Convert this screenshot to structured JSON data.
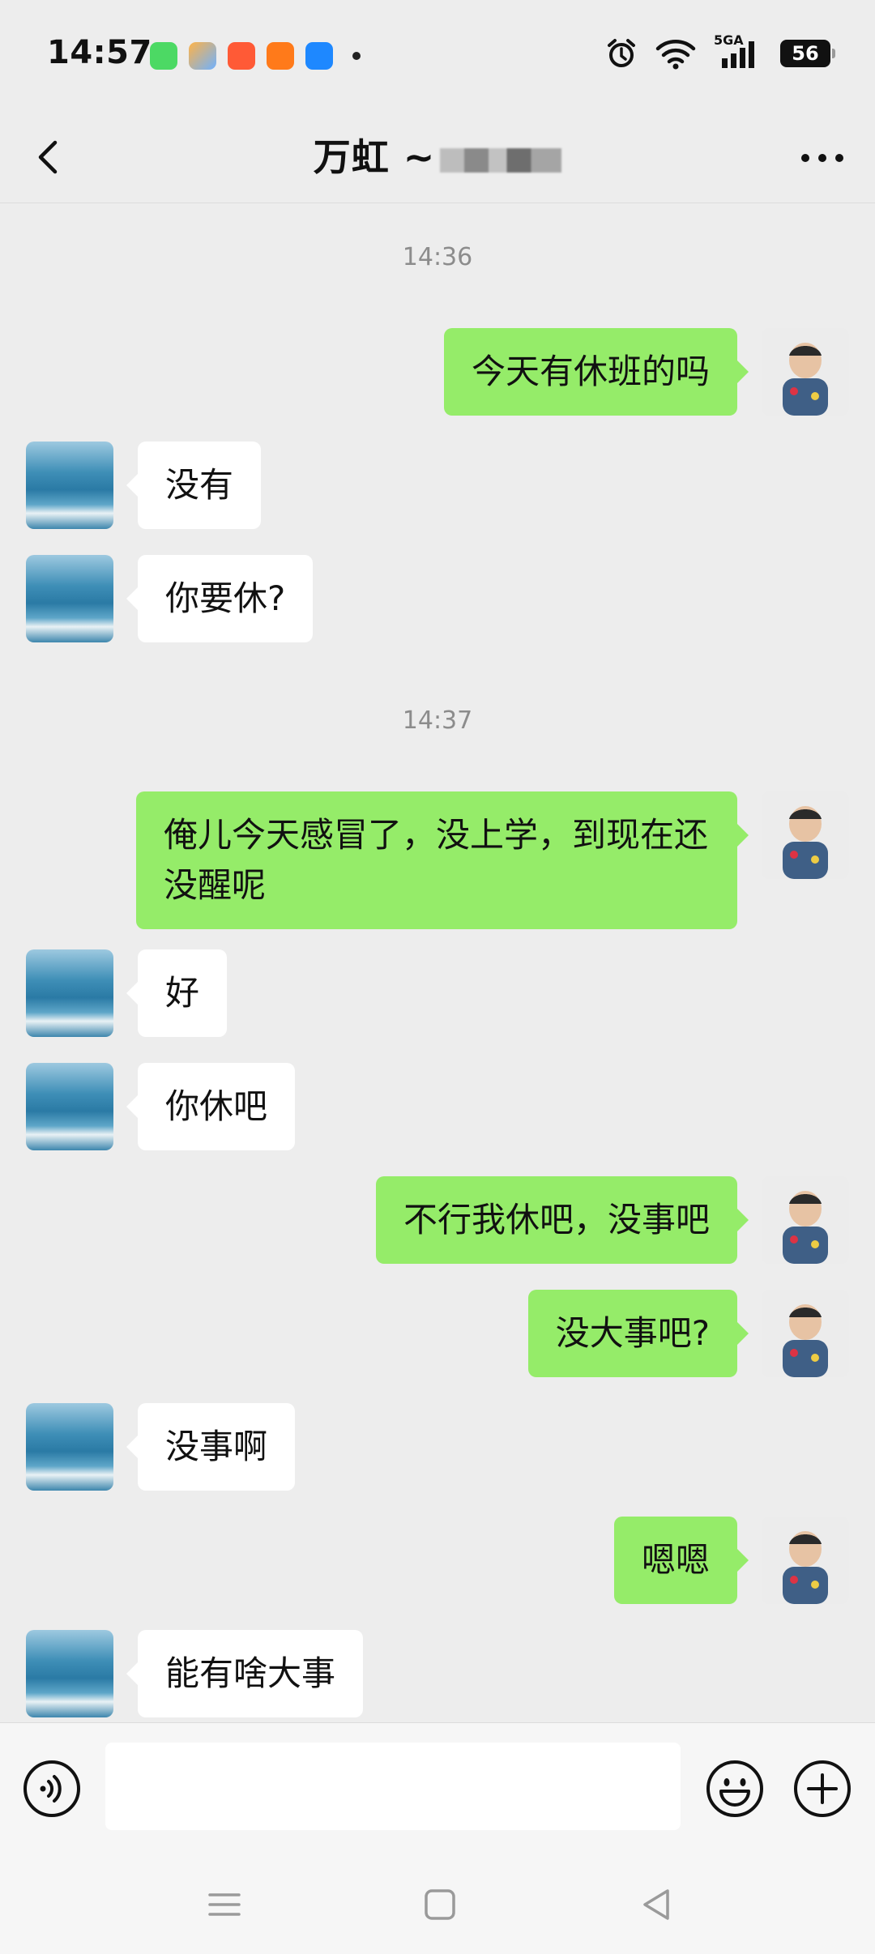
{
  "status_bar": {
    "time": "14:57",
    "network_label": "5GA",
    "battery": "56"
  },
  "header": {
    "title": "万虹 ~",
    "back_icon": "chevron-left-icon",
    "more_icon": "more-dots-icon"
  },
  "chat": {
    "timestamps": [
      "14:36",
      "14:37"
    ],
    "messages": [
      {
        "side": "out",
        "text": "今天有休班的吗"
      },
      {
        "side": "in",
        "text": "没有"
      },
      {
        "side": "in",
        "text": "你要休?"
      },
      {
        "side": "out",
        "text": "俺儿今天感冒了，没上学，到现在还没醒呢"
      },
      {
        "side": "in",
        "text": "好"
      },
      {
        "side": "in",
        "text": "你休吧"
      },
      {
        "side": "out",
        "text": "不行我休吧，没事吧"
      },
      {
        "side": "out",
        "text": "没大事吧?"
      },
      {
        "side": "in",
        "text": "没事啊"
      },
      {
        "side": "out",
        "text": "嗯嗯"
      },
      {
        "side": "in",
        "text": "能有啥大事"
      }
    ]
  },
  "input_bar": {
    "voice_icon": "voice-icon",
    "emoji_icon": "emoji-icon",
    "plus_icon": "plus-icon",
    "input_value": ""
  },
  "nav_bar": {
    "icons": [
      "menu-icon",
      "home-square-icon",
      "back-triangle-icon"
    ]
  },
  "colors": {
    "background": "#ededed",
    "bubble_out": "#95ec69",
    "bubble_in": "#ffffff"
  }
}
